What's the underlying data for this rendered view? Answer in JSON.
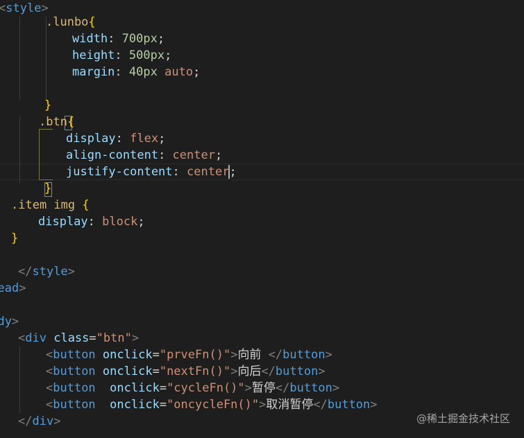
{
  "editor": {
    "lines": [
      {
        "tokens": [
          {
            "c": "t-punc",
            "t": "<"
          },
          {
            "c": "t-tag",
            "t": "style"
          },
          {
            "c": "t-punc",
            "t": ">"
          }
        ]
      },
      {
        "tokens": [
          {
            "c": "t-sel",
            "t": ".lunbo"
          },
          {
            "c": "t-brace-y",
            "t": "{"
          }
        ]
      },
      {
        "tokens": [
          {
            "c": "t-prop",
            "t": "width"
          },
          {
            "c": "t-text",
            "t": ": "
          },
          {
            "c": "t-num",
            "t": "700px"
          },
          {
            "c": "t-semi",
            "t": ";"
          }
        ]
      },
      {
        "tokens": [
          {
            "c": "t-prop",
            "t": "height"
          },
          {
            "c": "t-text",
            "t": ": "
          },
          {
            "c": "t-num",
            "t": "500px"
          },
          {
            "c": "t-semi",
            "t": ";"
          }
        ]
      },
      {
        "tokens": [
          {
            "c": "t-prop",
            "t": "margin"
          },
          {
            "c": "t-text",
            "t": ": "
          },
          {
            "c": "t-num",
            "t": "40px"
          },
          {
            "c": "t-text",
            "t": " "
          },
          {
            "c": "t-val",
            "t": "auto"
          },
          {
            "c": "t-semi",
            "t": ";"
          }
        ]
      },
      {
        "tokens": []
      },
      {
        "tokens": [
          {
            "c": "t-brace-y",
            "t": "}"
          }
        ]
      },
      {
        "tokens": [
          {
            "c": "t-sel",
            "t": ".btn"
          },
          {
            "c": "t-brace-y",
            "t": "{"
          }
        ]
      },
      {
        "tokens": [
          {
            "c": "t-prop",
            "t": "display"
          },
          {
            "c": "t-text",
            "t": ": "
          },
          {
            "c": "t-val",
            "t": "flex"
          },
          {
            "c": "t-semi",
            "t": ";"
          }
        ]
      },
      {
        "tokens": [
          {
            "c": "t-prop",
            "t": "align-content"
          },
          {
            "c": "t-text",
            "t": ": "
          },
          {
            "c": "t-val",
            "t": "center"
          },
          {
            "c": "t-semi",
            "t": ";"
          }
        ]
      },
      {
        "tokens": [
          {
            "c": "t-prop",
            "t": "justify-content"
          },
          {
            "c": "t-text",
            "t": ": "
          },
          {
            "c": "t-val",
            "t": "center"
          },
          {
            "c": "t-semi",
            "t": ";"
          }
        ]
      },
      {
        "tokens": [
          {
            "c": "t-brace-y",
            "t": "}"
          }
        ]
      },
      {
        "tokens": [
          {
            "c": "t-sel",
            "t": ".item img "
          },
          {
            "c": "t-brace-y",
            "t": "{"
          }
        ]
      },
      {
        "tokens": [
          {
            "c": "t-prop",
            "t": "display"
          },
          {
            "c": "t-text",
            "t": ": "
          },
          {
            "c": "t-val",
            "t": "block"
          },
          {
            "c": "t-semi",
            "t": ";"
          }
        ]
      },
      {
        "tokens": [
          {
            "c": "t-brace-y",
            "t": "}"
          }
        ]
      },
      {
        "tokens": []
      },
      {
        "tokens": [
          {
            "c": "t-punc",
            "t": "</"
          },
          {
            "c": "t-tag",
            "t": "style"
          },
          {
            "c": "t-punc",
            "t": ">"
          }
        ]
      },
      {
        "tokens": [
          {
            "c": "t-tag",
            "t": "/head"
          },
          {
            "c": "t-punc",
            "t": ">"
          }
        ]
      },
      {
        "tokens": []
      },
      {
        "tokens": [
          {
            "c": "t-tag",
            "t": "body"
          },
          {
            "c": "t-punc",
            "t": ">"
          }
        ]
      },
      {
        "tokens": [
          {
            "c": "t-punc",
            "t": "<"
          },
          {
            "c": "t-tag",
            "t": "div"
          },
          {
            "c": "t-text",
            "t": " "
          },
          {
            "c": "t-attr",
            "t": "class"
          },
          {
            "c": "t-text",
            "t": "="
          },
          {
            "c": "t-str",
            "t": "\"btn\""
          },
          {
            "c": "t-punc",
            "t": ">"
          }
        ]
      },
      {
        "tokens": [
          {
            "c": "t-punc",
            "t": "<"
          },
          {
            "c": "t-tag",
            "t": "button"
          },
          {
            "c": "t-text",
            "t": " "
          },
          {
            "c": "t-attr",
            "t": "onclick"
          },
          {
            "c": "t-text",
            "t": "="
          },
          {
            "c": "t-str",
            "t": "\"prveFn()\""
          },
          {
            "c": "t-punc",
            "t": ">"
          },
          {
            "c": "t-text",
            "t": "向前 "
          },
          {
            "c": "t-punc",
            "t": "</"
          },
          {
            "c": "t-tag",
            "t": "button"
          },
          {
            "c": "t-punc",
            "t": ">"
          }
        ]
      },
      {
        "tokens": [
          {
            "c": "t-punc",
            "t": "<"
          },
          {
            "c": "t-tag",
            "t": "button"
          },
          {
            "c": "t-text",
            "t": " "
          },
          {
            "c": "t-attr",
            "t": "onclick"
          },
          {
            "c": "t-text",
            "t": "="
          },
          {
            "c": "t-str",
            "t": "\"nextFn()\""
          },
          {
            "c": "t-punc",
            "t": ">"
          },
          {
            "c": "t-text",
            "t": "向后"
          },
          {
            "c": "t-punc",
            "t": "</"
          },
          {
            "c": "t-tag",
            "t": "button"
          },
          {
            "c": "t-punc",
            "t": ">"
          }
        ]
      },
      {
        "tokens": [
          {
            "c": "t-punc",
            "t": "<"
          },
          {
            "c": "t-tag",
            "t": "button"
          },
          {
            "c": "t-text",
            "t": "  "
          },
          {
            "c": "t-attr",
            "t": "onclick"
          },
          {
            "c": "t-text",
            "t": "="
          },
          {
            "c": "t-str",
            "t": "\"cycleFn()\""
          },
          {
            "c": "t-punc",
            "t": ">"
          },
          {
            "c": "t-text",
            "t": "暂停"
          },
          {
            "c": "t-punc",
            "t": "</"
          },
          {
            "c": "t-tag",
            "t": "button"
          },
          {
            "c": "t-punc",
            "t": ">"
          }
        ]
      },
      {
        "tokens": [
          {
            "c": "t-punc",
            "t": "<"
          },
          {
            "c": "t-tag",
            "t": "button"
          },
          {
            "c": "t-text",
            "t": "  "
          },
          {
            "c": "t-attr",
            "t": "onclick"
          },
          {
            "c": "t-text",
            "t": "="
          },
          {
            "c": "t-str",
            "t": "\"oncycleFn()\""
          },
          {
            "c": "t-punc",
            "t": ">"
          },
          {
            "c": "t-text",
            "t": "取消暂停"
          },
          {
            "c": "t-punc",
            "t": "</"
          },
          {
            "c": "t-tag",
            "t": "button"
          },
          {
            "c": "t-punc",
            "t": ">"
          }
        ]
      },
      {
        "tokens": [
          {
            "c": "t-punc",
            "t": "</"
          },
          {
            "c": "t-tag",
            "t": "div"
          },
          {
            "c": "t-punc",
            "t": ">"
          }
        ]
      }
    ]
  },
  "watermark": {
    "text": "@稀土掘金技术社区"
  },
  "colors": {
    "background": "#1e1e1e",
    "tag": "#569cd6",
    "property": "#9cdcfe",
    "string": "#ce9178",
    "number": "#b5cea8",
    "selector": "#d7ba7d",
    "brace": "#ffd700"
  }
}
